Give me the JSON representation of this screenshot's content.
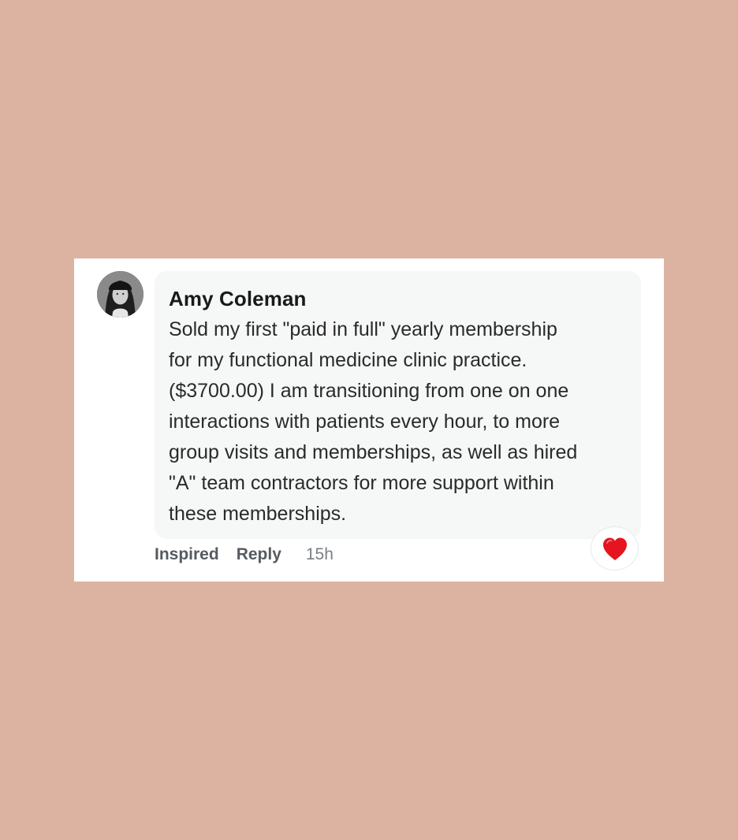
{
  "comment": {
    "author": "Amy Coleman",
    "avatar_icon": "user-avatar",
    "text": "Sold my first \"paid in full\" yearly membership\nfor my functional medicine clinic practice.\n($3700.00) I am transitioning from one on one\ninteractions with patients every hour, to more\ngroup visits and memberships, as well as hired\n\"A\" team contractors for more support within\nthese memberships.",
    "actions": {
      "inspired_label": "Inspired",
      "reply_label": "Reply"
    },
    "timestamp": "15h",
    "reaction": {
      "icon": "heart-icon",
      "color": "#e5141f"
    }
  },
  "colors": {
    "page_background": "#dcb3a1",
    "card_background": "#ffffff",
    "bubble_background": "#f6f7f7"
  }
}
